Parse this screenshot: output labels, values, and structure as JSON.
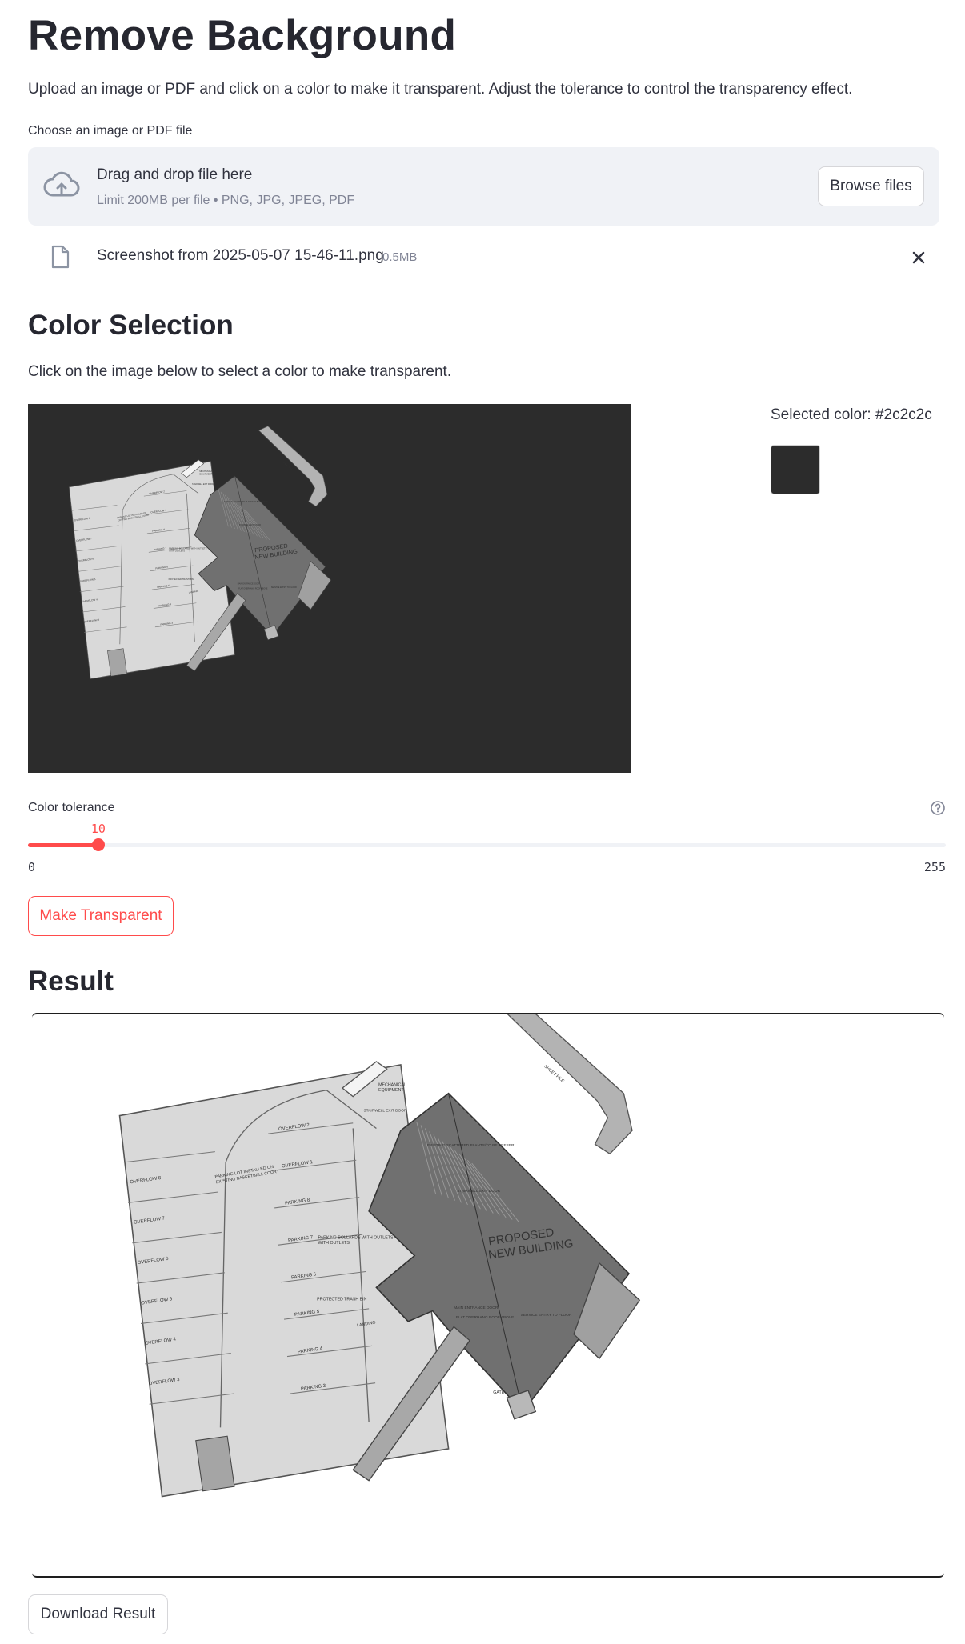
{
  "header": {
    "title": "Remove Background",
    "description": "Upload an image or PDF and click on a color to make it transparent. Adjust the tolerance to control the transparency effect."
  },
  "uploader": {
    "label": "Choose an image or PDF file",
    "drag_text": "Drag and drop file here",
    "limit_text": "Limit 200MB per file • PNG, JPG, JPEG, PDF",
    "browse_label": "Browse files",
    "file": {
      "name": "Screenshot from 2025-05-07 15-46-11.png",
      "size": "0.5MB"
    }
  },
  "color_selection": {
    "heading": "Color Selection",
    "instruction": "Click on the image below to select a color to make transparent.",
    "selected_label": "Selected color: #2c2c2c",
    "selected_hex": "#2c2c2c"
  },
  "plan": {
    "building_line1": "PROPOSED",
    "building_line2": "NEW BUILDING",
    "lot_label_1": "PARKING LOT INSTALLED ON",
    "lot_label_2": "EXISTING BASKETBALL COURT",
    "left_labels": [
      "OVERFLOW 8",
      "OVERFLOW 7",
      "OVERFLOW 6",
      "OVERFLOW 5",
      "OVERFLOW 4",
      "OVERFLOW 3"
    ],
    "right_labels": [
      "OVERFLOW 2",
      "OVERFLOW 1",
      "PARKING 8",
      "PARKING 7",
      "PARKING 6",
      "PARKING 5",
      "PARKING 4",
      "PARKING 3"
    ],
    "bollards": "PARKING BOLLARDS WITH OUTLETS",
    "bollards_line2": "WITH OUTLETS",
    "trash": "PROTECTED TRASH BIN",
    "landing": "LANDING",
    "gate": "GATE",
    "sheet_pile": "SHEET PILE",
    "mech_1": "MECHANICAL",
    "mech_2": "EQUIPMENT",
    "notes": [
      "EXISTING SCATTERED PLANTS/TO BE PRESERVED WITH NEW PROTECTION FOR CONSTRUCTION",
      "STAIRWELL EXIT DOOR",
      "MAIN ENTRANCE DOOR",
      "FLAT OVERHANG ROOF ABOVE",
      "SERVICE ENTRY TO FLOOR",
      "STAIRWELL EXIT DOOR"
    ]
  },
  "tolerance": {
    "label": "Color tolerance",
    "value": 10,
    "min": 0,
    "max": 255,
    "value_text": "10",
    "min_text": "0",
    "max_text": "255"
  },
  "make_transparent_label": "Make Transparent",
  "result": {
    "heading": "Result",
    "download_label": "Download Result"
  },
  "colors": {
    "accent": "#ff4b4b",
    "canvas_bg": "#2c2c2c",
    "lot_fill": "#d9d9d9",
    "building_fill": "#707070"
  },
  "icons": {
    "upload": "cloud-upload-icon",
    "file": "file-icon",
    "close": "close-icon",
    "help": "help-circle-icon"
  }
}
